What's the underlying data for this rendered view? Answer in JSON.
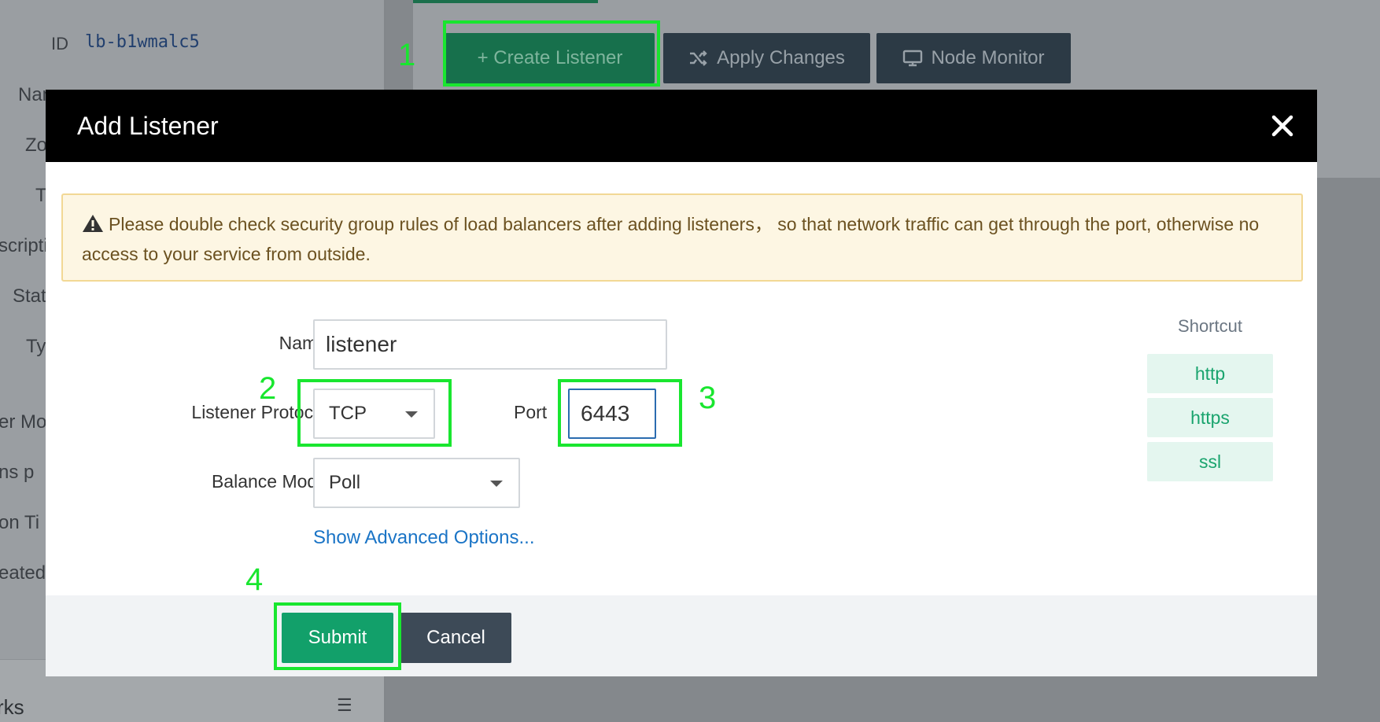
{
  "background": {
    "id_label": "ID",
    "id_value": "lb-b1wmalc5",
    "detail_labels": [
      "Nam",
      "Zo",
      "T",
      "scripti",
      "Stat",
      "Ty",
      "er Mo",
      "ns p",
      "on Ti",
      "eated"
    ],
    "bottom_section": "rks",
    "toolbar": {
      "create_label": "+ Create Listener",
      "apply_label": "Apply Changes",
      "monitor_label": "Node Monitor"
    }
  },
  "annotations": [
    "1",
    "2",
    "3",
    "4"
  ],
  "modal": {
    "title": "Add Listener",
    "warning": "Please double check security group rules of load balancers after adding listeners， so that network traffic can get through the port, otherwise no access to your service from outside.",
    "form": {
      "name_label": "Name",
      "name_value": "listener",
      "protocol_label": "Listener Protocol",
      "protocol_value": "TCP",
      "port_label": "Port",
      "port_value": "6443",
      "balance_label": "Balance Mode",
      "balance_value": "Poll",
      "advanced_link": "Show Advanced Options..."
    },
    "shortcut": {
      "title": "Shortcut",
      "items": [
        "http",
        "https",
        "ssl"
      ]
    },
    "footer": {
      "submit_label": "Submit",
      "cancel_label": "Cancel"
    }
  },
  "colors": {
    "annotation": "#19e62f",
    "primary": "#12a06a",
    "dark": "#3d4a57",
    "link": "#1a74c6"
  }
}
